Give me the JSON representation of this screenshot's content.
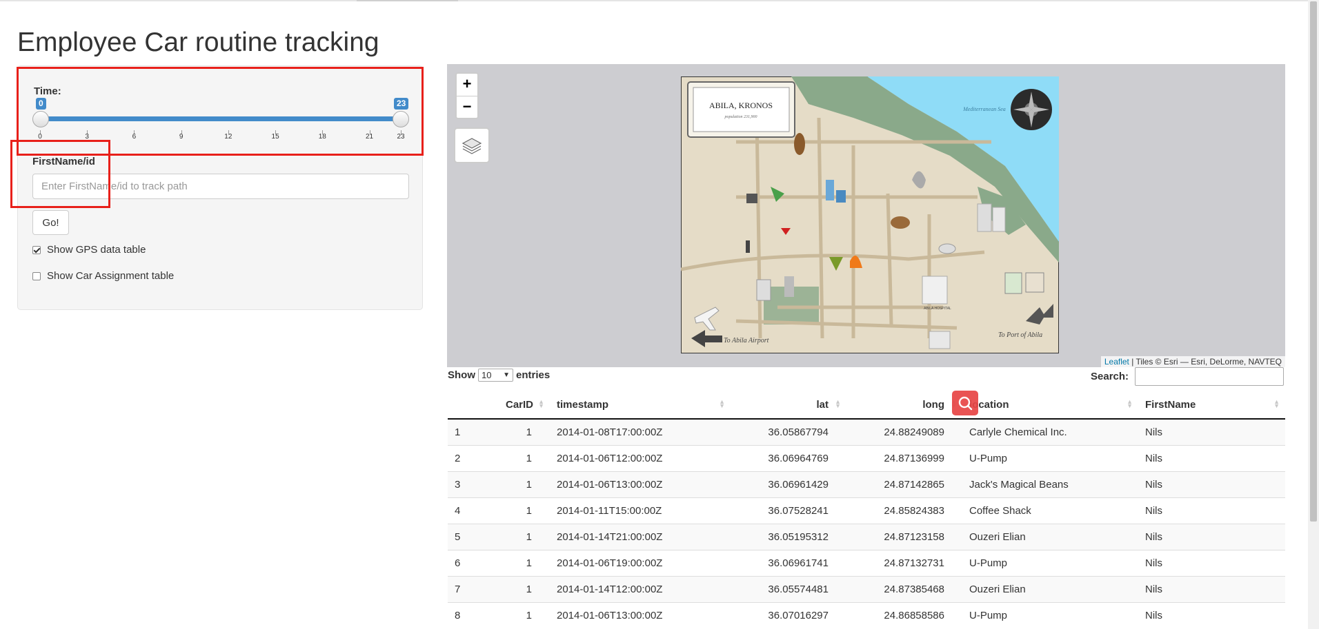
{
  "page": {
    "title": "Employee Car routine tracking"
  },
  "sidebar": {
    "time_label": "Time:",
    "slider": {
      "min": 0,
      "max": 23,
      "from": 0,
      "to": 23,
      "from_label": "0",
      "to_label": "23",
      "ticks": [
        "0",
        "3",
        "6",
        "9",
        "12",
        "15",
        "18",
        "21",
        "23"
      ]
    },
    "name_label": "FirstName/id",
    "name_placeholder": "Enter FirstName/id to track path",
    "name_value": "",
    "go_label": "Go!",
    "show_gps": {
      "label": "Show GPS data table",
      "checked": true
    },
    "show_assignment": {
      "label": "Show Car Assignment table",
      "checked": false
    }
  },
  "map": {
    "zoom_in": "+",
    "zoom_out": "−",
    "title": "ABILA, KRONOS",
    "subtitle": "population 231,900",
    "sea_label": "Mediterranean Sea",
    "hospital_label": "ABILA HOSPITAL",
    "airport_label": "To Abila Airport",
    "port_label": "To Port of Abila",
    "attribution_leaflet": "Leaflet",
    "attribution_rest": " | Tiles © Esri — Esri, DeLorme, NAVTEQ"
  },
  "table": {
    "show_label": "Show",
    "entries_label": "entries",
    "page_length": "10",
    "search_label": "Search:",
    "search_value": "",
    "columns": [
      "",
      "CarID",
      "timestamp",
      "lat",
      "long",
      "location",
      "FirstName"
    ],
    "rows": [
      [
        "1",
        "1",
        "2014-01-08T17:00:00Z",
        "36.05867794",
        "24.88249089",
        "Carlyle Chemical Inc.",
        "Nils"
      ],
      [
        "2",
        "1",
        "2014-01-06T12:00:00Z",
        "36.06964769",
        "24.87136999",
        "U-Pump",
        "Nils"
      ],
      [
        "3",
        "1",
        "2014-01-06T13:00:00Z",
        "36.06961429",
        "24.87142865",
        "Jack's Magical Beans",
        "Nils"
      ],
      [
        "4",
        "1",
        "2014-01-11T15:00:00Z",
        "36.07528241",
        "24.85824383",
        "Coffee Shack",
        "Nils"
      ],
      [
        "5",
        "1",
        "2014-01-14T21:00:00Z",
        "36.05195312",
        "24.87123158",
        "Ouzeri Elian",
        "Nils"
      ],
      [
        "6",
        "1",
        "2014-01-06T19:00:00Z",
        "36.06961741",
        "24.87132731",
        "U-Pump",
        "Nils"
      ],
      [
        "7",
        "1",
        "2014-01-14T12:00:00Z",
        "36.05574481",
        "24.87385468",
        "Ouzeri Elian",
        "Nils"
      ],
      [
        "8",
        "1",
        "2014-01-06T13:00:00Z",
        "36.07016297",
        "24.86858586",
        "U-Pump",
        "Nils"
      ]
    ]
  },
  "colors": {
    "slider_accent": "#428bca",
    "annotation_red": "#e8201a",
    "map_background": "#cdcdd1",
    "sea": "#8fdcf7",
    "park": "#8aa98a",
    "land": "#e5dcc7",
    "road": "#c9b99a"
  },
  "icons": {
    "layers": "layers-icon",
    "search_overlay": "search-icon",
    "compass": "compass-icon"
  }
}
